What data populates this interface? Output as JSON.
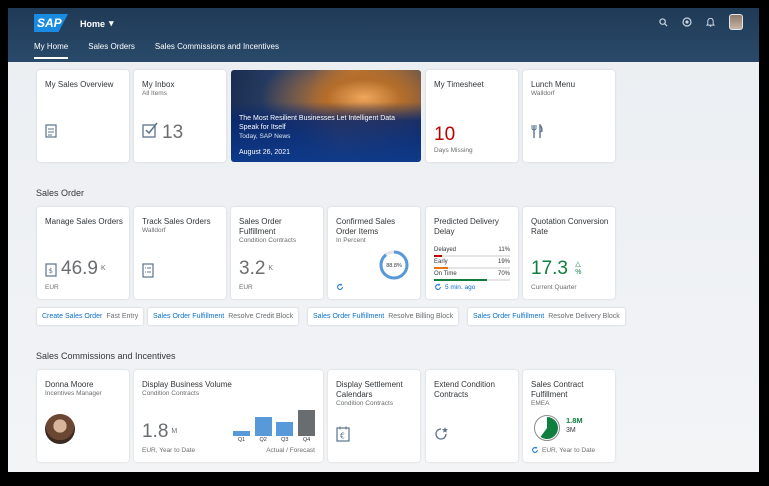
{
  "shell": {
    "logo": "SAP",
    "home_label": "Home",
    "home_caret": "▾",
    "tabs": [
      "My Home",
      "Sales Orders",
      "Sales Commissions and Incentives"
    ]
  },
  "row1": {
    "sales_overview": {
      "title": "My Sales Overview"
    },
    "inbox": {
      "title": "My Inbox",
      "subtitle": "All Items",
      "count": "13"
    },
    "news": {
      "title": "The Most Resilient Businesses Let Intelligent Data Speak for Itself",
      "subtitle": "Today, SAP News",
      "date": "August 26, 2021"
    },
    "timesheet": {
      "title": "My Timesheet",
      "value": "10",
      "footer": "Days Missing",
      "value_color": "#bb0000"
    },
    "lunch": {
      "title": "Lunch Menu",
      "subtitle": "Walldorf"
    }
  },
  "sales_order": {
    "section_title": "Sales Order",
    "manage": {
      "title": "Manage Sales Orders",
      "value": "46.9",
      "scale": "K",
      "footer": "EUR"
    },
    "track": {
      "title": "Track Sales Orders",
      "subtitle": "Walldorf"
    },
    "fulfillment": {
      "title": "Sales Order Fulfillment",
      "subtitle": "Condition Contracts",
      "value": "3.2",
      "scale": "K",
      "footer": "EUR"
    },
    "confirmed": {
      "title": "Confirmed Sales Order Items",
      "subtitle": "In Percent",
      "percent_label": "88.8%",
      "percent": 88.8
    },
    "delay": {
      "title": "Predicted Delivery Delay",
      "rows": [
        {
          "label": "Delayed",
          "pct": "11%",
          "value": 11,
          "color": "#bb0000"
        },
        {
          "label": "Early",
          "pct": "19%",
          "value": 19,
          "color": "#e9730c"
        },
        {
          "label": "On Time",
          "pct": "70%",
          "value": 70,
          "color": "#107e3e"
        }
      ],
      "footer": "5 min. ago"
    },
    "quotation": {
      "title": "Quotation Conversion Rate",
      "value": "17.3",
      "unit": "%",
      "trend": "△",
      "footer": "Current Quarter",
      "value_color": "#107e3e"
    }
  },
  "links": [
    {
      "link": "Create Sales Order",
      "sub": "Fast Entry"
    },
    {
      "link": "Sales Order Fulfillment",
      "sub": "Resolve Credit Block"
    },
    {
      "link": "Sales Order Fulfillment",
      "sub": "Resolve Billing Block"
    },
    {
      "link": "Sales Order Fulfillment",
      "sub": "Resolve Delivery Block"
    }
  ],
  "commissions": {
    "section_title": "Sales Commissions and Incentives",
    "person": {
      "title": "Donna Moore",
      "subtitle": "Incentives Manager"
    },
    "volume": {
      "title": "Display Business Volume",
      "subtitle": "Condition Contracts",
      "value": "1.8",
      "scale": "M",
      "footer": "EUR, Year to Date",
      "footer_right": "Actual / Forecast",
      "quarters": [
        {
          "label": "Q1",
          "value": 0.2,
          "color": "#5899da"
        },
        {
          "label": "Q2",
          "value": 0.75,
          "color": "#5899da"
        },
        {
          "label": "Q3",
          "value": 0.55,
          "color": "#5899da"
        },
        {
          "label": "Q4",
          "value": 1.0,
          "color": "#6a6d70"
        }
      ]
    },
    "settlement": {
      "title": "Display Settlement Calendars",
      "subtitle": "Condition Contracts"
    },
    "extend": {
      "title": "Extend Condition Contracts"
    },
    "contract": {
      "title": "Sales Contract Fulfillment",
      "subtitle": "EMEA",
      "value_high": "1.8M",
      "value_low": "3M",
      "fraction": 0.6,
      "footer": "EUR, Year to Date",
      "accent": "#107e3e"
    }
  }
}
